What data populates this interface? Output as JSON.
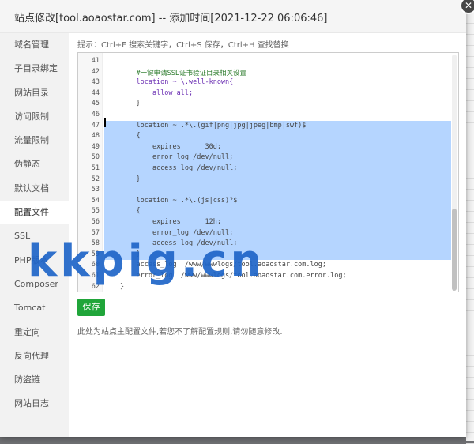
{
  "dialog": {
    "title": "站点修改[tool.aoaostar.com] -- 添加时间[2021-12-22 06:06:46]",
    "close_icon": "✕"
  },
  "sidebar": {
    "items": [
      {
        "label": "域名管理"
      },
      {
        "label": "子目录绑定"
      },
      {
        "label": "网站目录"
      },
      {
        "label": "访问限制"
      },
      {
        "label": "流量限制"
      },
      {
        "label": "伪静态"
      },
      {
        "label": "默认文档"
      },
      {
        "label": "配置文件",
        "active": true
      },
      {
        "label": "SSL"
      },
      {
        "label": "PHP版本"
      },
      {
        "label": "Composer"
      },
      {
        "label": "Tomcat"
      },
      {
        "label": "重定向"
      },
      {
        "label": "反向代理"
      },
      {
        "label": "防盗链"
      },
      {
        "label": "网站日志"
      }
    ]
  },
  "hint": "提示：Ctrl+F 搜索关键字，Ctrl+S 保存，Ctrl+H 查找替换",
  "editor": {
    "lines": [
      {
        "num": "41",
        "text": "",
        "selected": false,
        "color": "#444444"
      },
      {
        "num": "42",
        "text": "    #一键申请SSL证书验证目录相关设置",
        "selected": false,
        "color": "#2a7a2a"
      },
      {
        "num": "43",
        "text": "    location ~ \\.well-known{",
        "selected": false,
        "color": "#6b2fb3"
      },
      {
        "num": "44",
        "text": "        allow all;",
        "selected": false,
        "color": "#6b2fb3"
      },
      {
        "num": "45",
        "text": "    }",
        "selected": false,
        "color": "#444444"
      },
      {
        "num": "46",
        "text": "",
        "selected": false,
        "color": "#444444"
      },
      {
        "num": "47",
        "text": "    location ~ .*\\.(gif|png|jpg|jpeg|bmp|swf)$",
        "selected": true,
        "color": "#444444"
      },
      {
        "num": "48",
        "text": "    {",
        "selected": true,
        "color": "#444444"
      },
      {
        "num": "49",
        "text": "        expires      30d;",
        "selected": true,
        "color": "#444444"
      },
      {
        "num": "50",
        "text": "        error_log /dev/null;",
        "selected": true,
        "color": "#444444"
      },
      {
        "num": "51",
        "text": "        access_log /dev/null;",
        "selected": true,
        "color": "#444444"
      },
      {
        "num": "52",
        "text": "    }",
        "selected": true,
        "color": "#444444"
      },
      {
        "num": "53",
        "text": "",
        "selected": true,
        "color": "#444444"
      },
      {
        "num": "54",
        "text": "    location ~ .*\\.(js|css)?$",
        "selected": true,
        "color": "#444444"
      },
      {
        "num": "55",
        "text": "    {",
        "selected": true,
        "color": "#444444"
      },
      {
        "num": "56",
        "text": "        expires      12h;",
        "selected": true,
        "color": "#444444"
      },
      {
        "num": "57",
        "text": "        error_log /dev/null;",
        "selected": true,
        "color": "#444444"
      },
      {
        "num": "58",
        "text": "        access_log /dev/null;",
        "selected": true,
        "color": "#444444"
      },
      {
        "num": "59",
        "text": "    }",
        "selected": true,
        "color": "#444444"
      },
      {
        "num": "60",
        "text": "    access_log  /www/wwwlogs/tool.aoaostar.com.log;",
        "selected": false,
        "color": "#444444"
      },
      {
        "num": "61",
        "text": "    error_log  /www/wwwlogs/tool.aoaostar.com.error.log;",
        "selected": false,
        "color": "#444444"
      },
      {
        "num": "62",
        "text": "}",
        "selected": false,
        "color": "#444444"
      }
    ]
  },
  "save_label": "保存",
  "note": "此处为站点主配置文件,若您不了解配置规则,请勿随意修改.",
  "watermark": "kkpig.cn"
}
